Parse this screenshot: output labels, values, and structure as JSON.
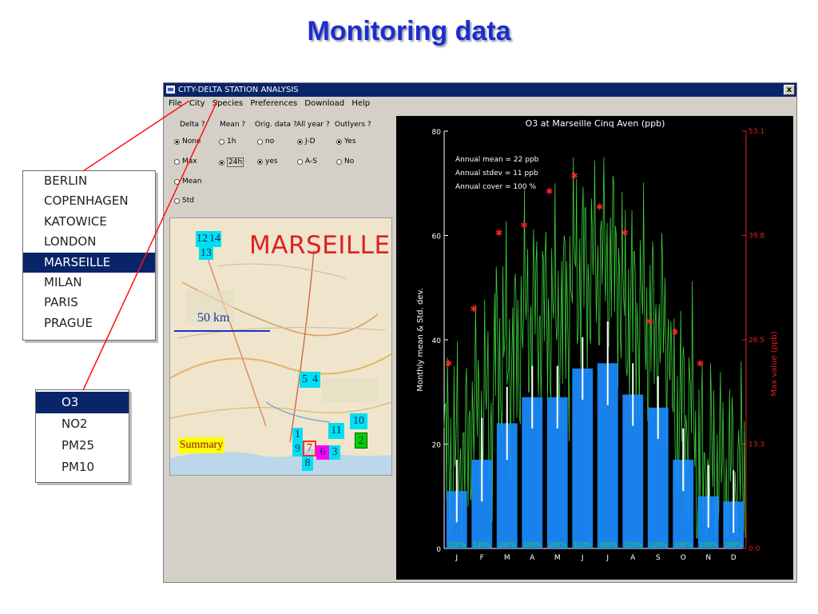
{
  "slide_title": "Monitoring data",
  "window": {
    "title": "CITY-DELTA STATION ANALYSIS",
    "close_label": "x",
    "menu": [
      "File",
      "City",
      "Species",
      "Preferences",
      "Download",
      "Help"
    ]
  },
  "options": {
    "headers": [
      "Delta ?",
      "Mean ?",
      "Orig. data ?",
      "All year ?",
      "Outlyers ?"
    ],
    "delta": [
      {
        "label": "None",
        "checked": true
      },
      {
        "label": "Max",
        "checked": false
      },
      {
        "label": "Mean",
        "checked": false
      },
      {
        "label": "Std",
        "checked": false
      }
    ],
    "mean": [
      {
        "label": "1h",
        "checked": false
      },
      {
        "label": "24h",
        "checked": true
      }
    ],
    "orig": [
      {
        "label": "no",
        "checked": false
      },
      {
        "label": "yes",
        "checked": true
      }
    ],
    "allyear": [
      {
        "label": "J-D",
        "checked": true
      },
      {
        "label": "A-S",
        "checked": false
      }
    ],
    "outlyers": [
      {
        "label": "Yes",
        "checked": true
      },
      {
        "label": "No",
        "checked": false
      }
    ]
  },
  "map": {
    "city_name": "MARSEILLE",
    "scale_label": "50 km",
    "summary_label": "Summary",
    "stations": [
      {
        "label": "12",
        "color": "#00e0f0"
      },
      {
        "label": "14",
        "color": "#00e0f0"
      },
      {
        "label": "13",
        "color": "#00e0f0"
      },
      {
        "label": "5",
        "color": "#00e0f0"
      },
      {
        "label": "4",
        "color": "#00e0f0"
      },
      {
        "label": "1",
        "color": "#00e0f0"
      },
      {
        "label": "9",
        "color": "#00e0f0"
      },
      {
        "label": "7",
        "color": "#ff3030"
      },
      {
        "label": "6",
        "color": "#ff00ff"
      },
      {
        "label": "3",
        "color": "#00e0f0"
      },
      {
        "label": "8",
        "color": "#00e0f0"
      },
      {
        "label": "11",
        "color": "#00e0f0"
      },
      {
        "label": "10",
        "color": "#00e0f0"
      },
      {
        "label": "2",
        "color": "#00d000"
      }
    ]
  },
  "city_list": {
    "items": [
      "BERLIN",
      "COPENHAGEN",
      "KATOWICE",
      "LONDON",
      "MARSEILLE",
      "MILAN",
      "PARIS",
      "PRAGUE"
    ],
    "selected": "MARSEILLE"
  },
  "species_list": {
    "items": [
      "O3",
      "NO2",
      "PM25",
      "PM10"
    ],
    "selected": "O3"
  },
  "chart_data": {
    "type": "bar",
    "title": "O3 at Marseille Cinq Aven  (ppb)",
    "categories": [
      "J",
      "F",
      "M",
      "A",
      "M",
      "J",
      "J",
      "A",
      "S",
      "O",
      "N",
      "D"
    ],
    "ylabel": "Monthly mean & Std. dev.",
    "y2label": "Max value  (ppb)",
    "ylim": [
      0,
      80
    ],
    "y_ticks": [
      "0",
      "20",
      "40",
      "60",
      "80"
    ],
    "y2_ticks": [
      "0.0",
      "13.3",
      "26.5",
      "39.8",
      "53.1"
    ],
    "colors": {
      "bar": "#1a8cff",
      "stdev": "#ffffff",
      "max": "#ff2020",
      "line": "#3ad23a",
      "right_axis": "#e02020"
    },
    "series": [
      {
        "name": "Monthly mean",
        "values": [
          11,
          17,
          24,
          29,
          29,
          34.5,
          35.5,
          29.5,
          27,
          17,
          10,
          9
        ]
      },
      {
        "name": "Std. dev.",
        "values": [
          6,
          8,
          7,
          6,
          6,
          6,
          8,
          6,
          6,
          6,
          6,
          6
        ]
      },
      {
        "name": "Max value",
        "values": [
          35.5,
          46,
          60.5,
          62,
          68.5,
          71.5,
          65.5,
          60.5,
          43.5,
          41.5,
          35.5,
          null
        ]
      }
    ],
    "annotations": [
      "Annual mean = 22 ppb",
      "Annual stdev  = 11 ppb",
      "Annual cover  = 100 %"
    ],
    "cover_labels": [
      "100%",
      "100%",
      "100%",
      "100%",
      "100%",
      "100%",
      "100%",
      "100%",
      "100%",
      "100%",
      "100%",
      "100%"
    ]
  }
}
